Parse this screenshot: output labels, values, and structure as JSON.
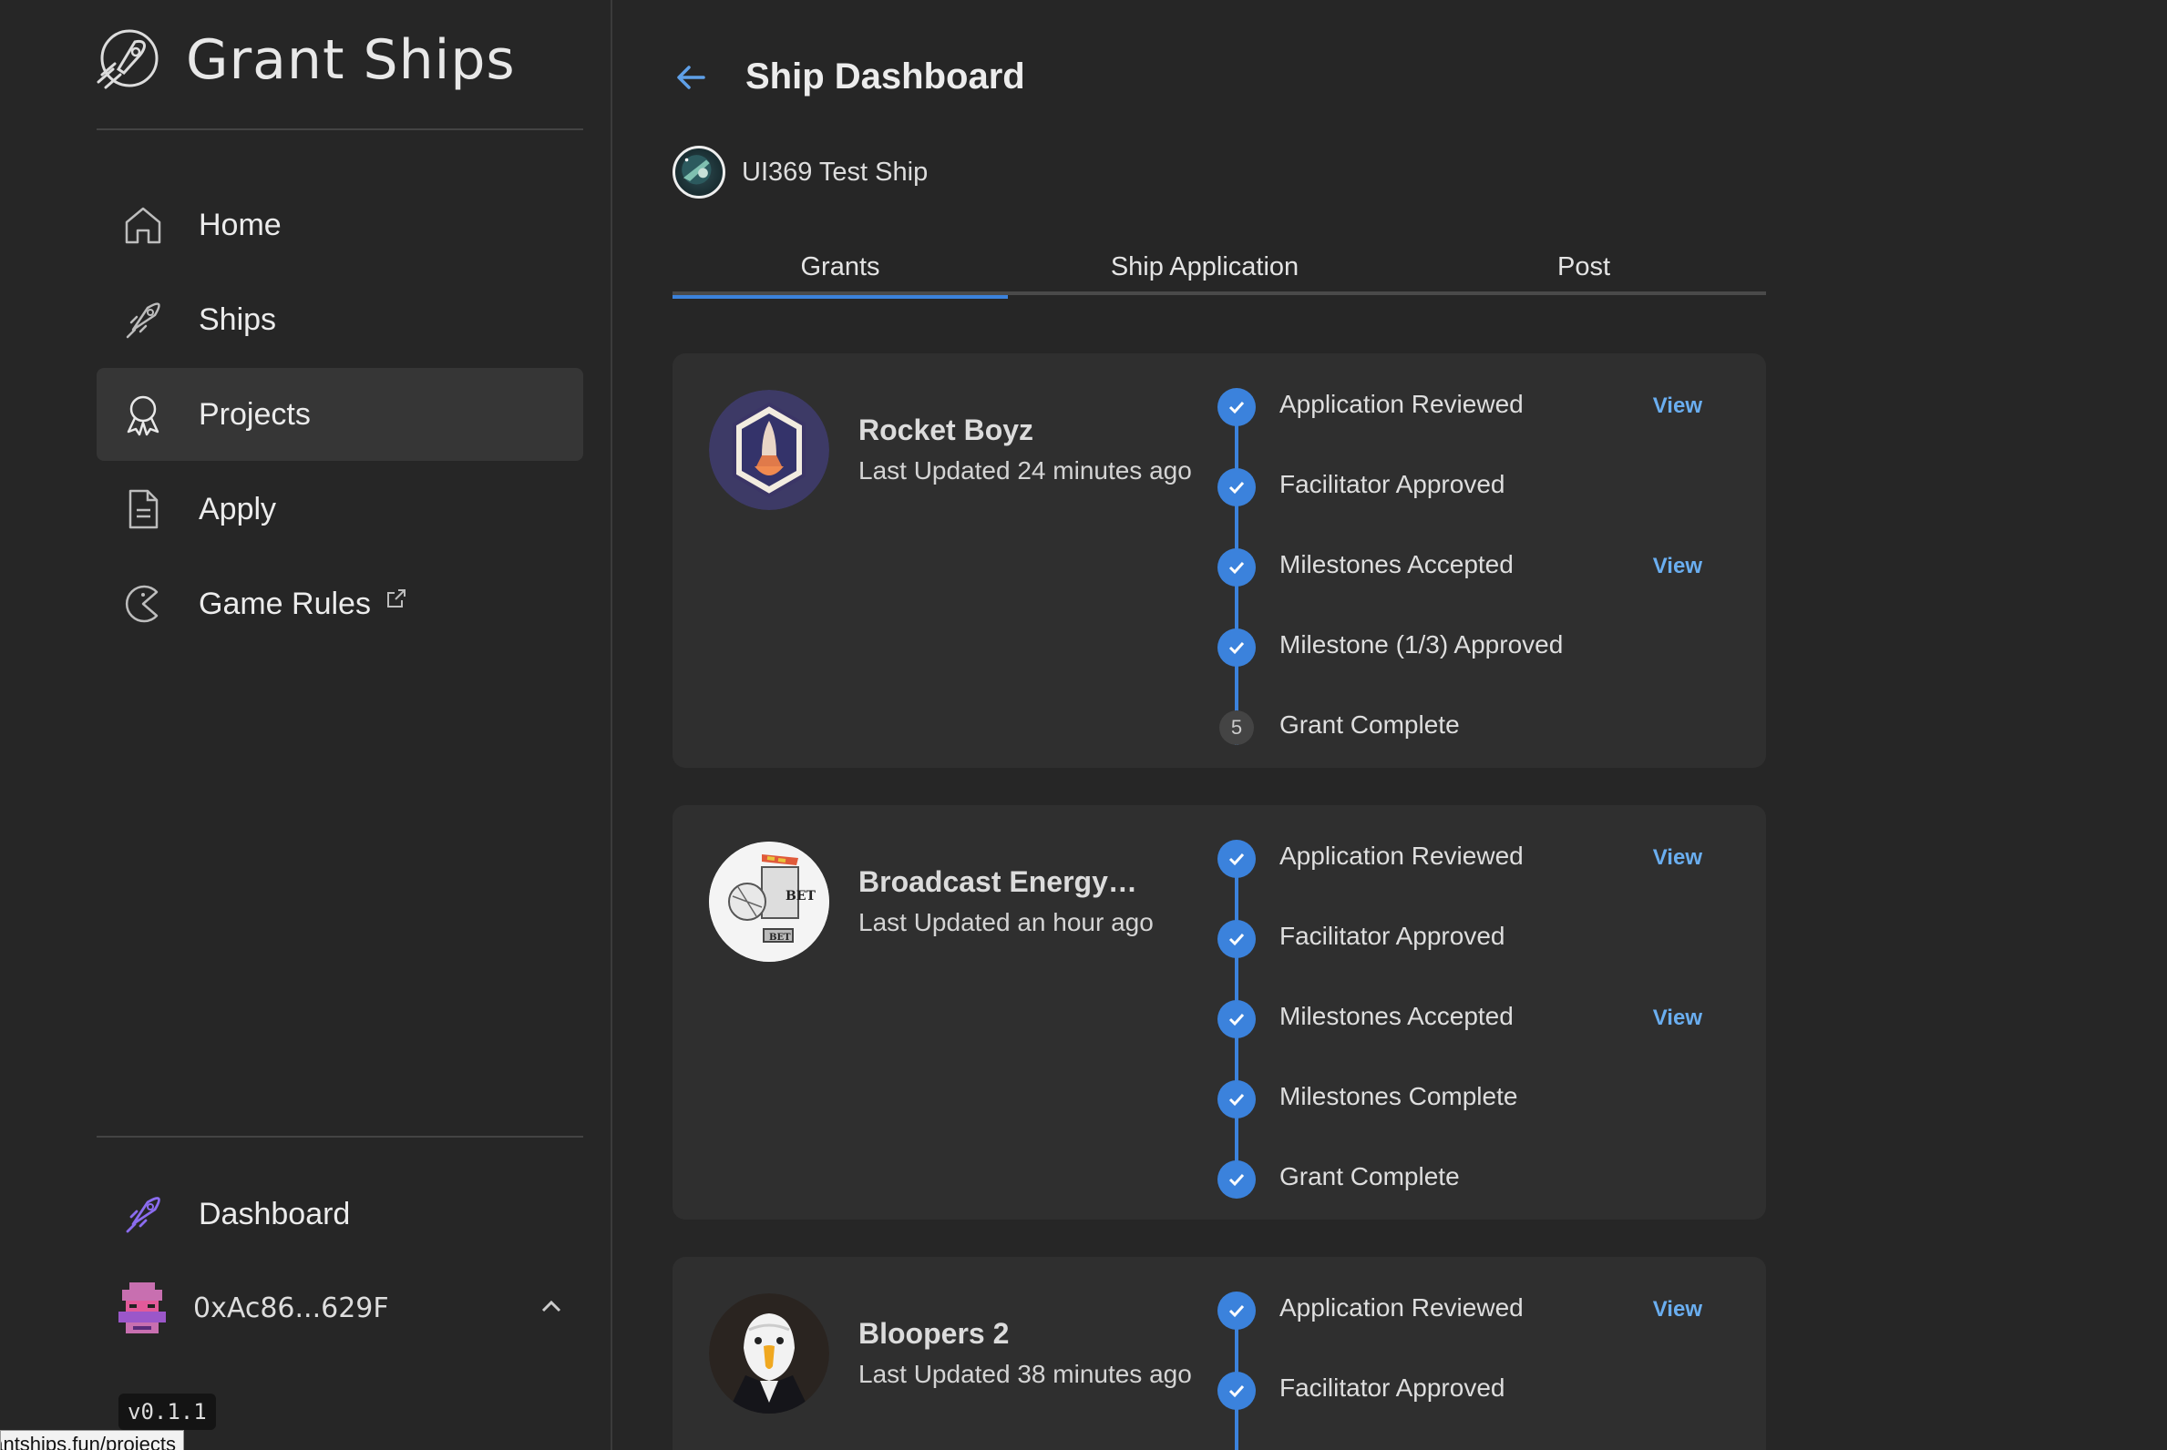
{
  "app": {
    "name": "Grant Ships"
  },
  "sidebar": {
    "items": [
      {
        "label": "Home",
        "icon": "home-icon"
      },
      {
        "label": "Ships",
        "icon": "rocket-icon"
      },
      {
        "label": "Projects",
        "icon": "award-icon",
        "active": true
      },
      {
        "label": "Apply",
        "icon": "file-icon"
      },
      {
        "label": "Game Rules",
        "icon": "pacman-icon",
        "external": true
      }
    ],
    "dashboard_label": "Dashboard",
    "wallet_address": "0xAc86...629F",
    "version": "v0.1.1",
    "status_url": "grantships.fun/projects"
  },
  "header": {
    "title": "Ship Dashboard"
  },
  "ship": {
    "name": "UI369 Test Ship"
  },
  "tabs": [
    {
      "label": "Grants",
      "active": true
    },
    {
      "label": "Ship Application"
    },
    {
      "label": "Post"
    }
  ],
  "grants": [
    {
      "name": "Rocket Boyz",
      "updated": "Last Updated 24 minutes ago",
      "steps": [
        {
          "label": "Application Reviewed",
          "done": true,
          "view": "View"
        },
        {
          "label": "Facilitator Approved",
          "done": true
        },
        {
          "label": "Milestones Accepted",
          "done": true,
          "view": "View"
        },
        {
          "label": "Milestone (1/3) Approved",
          "done": true
        },
        {
          "label": "Grant Complete",
          "done": false,
          "number": "5"
        }
      ]
    },
    {
      "name": "Broadcast Energy…",
      "updated": "Last Updated an hour ago",
      "steps": [
        {
          "label": "Application Reviewed",
          "done": true,
          "view": "View"
        },
        {
          "label": "Facilitator Approved",
          "done": true
        },
        {
          "label": "Milestones Accepted",
          "done": true,
          "view": "View"
        },
        {
          "label": "Milestones Complete",
          "done": true
        },
        {
          "label": "Grant Complete",
          "done": true
        }
      ]
    },
    {
      "name": "Bloopers 2",
      "updated": "Last Updated 38 minutes ago",
      "steps": [
        {
          "label": "Application Reviewed",
          "done": true,
          "view": "View"
        },
        {
          "label": "Facilitator Approved",
          "done": true
        }
      ]
    }
  ],
  "colors": {
    "accent": "#3b82dc",
    "link": "#6aaef0",
    "background": "#262626",
    "card": "#2f2f2f"
  }
}
